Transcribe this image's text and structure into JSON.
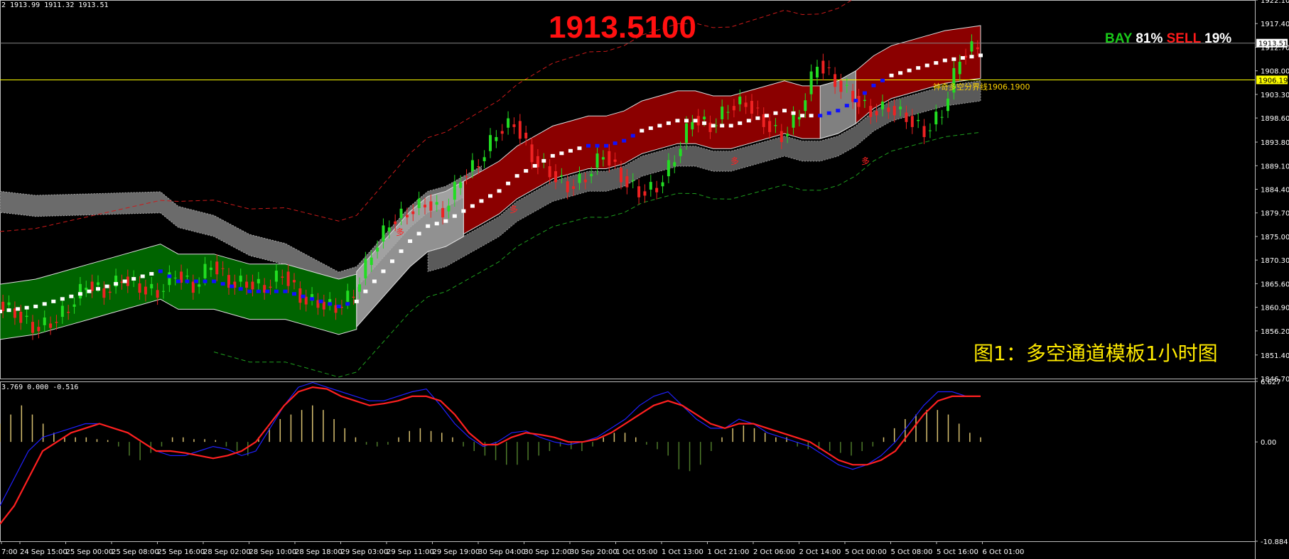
{
  "window": {
    "ohlc_header": "2 1913.99 1911.32 1913.51",
    "indicator_header": "3.769 0.000 -0.516"
  },
  "overlay": {
    "price_big": "1913.5100",
    "bay_label": "BAY",
    "bay_pct": "81%",
    "sell_label": "SELL",
    "sell_pct": "19%",
    "caption": "图1：多空通道模板1小时图",
    "reference_label": "神奇多空分界线1906.1900",
    "signal_mark": "多"
  },
  "colors": {
    "bull_channel": "#006400",
    "bear_channel": "#8b0000",
    "neutral_channel": "#808080",
    "bull_candle": "#22dd22",
    "bear_candle": "#ee2222",
    "mid_line": "#1010ff",
    "price_line": "#ffffff",
    "macd_fast": "#ff2020",
    "macd_slow": "#2020ff",
    "ref_line": "#ffff00"
  },
  "chart_data": [
    {
      "type": "line",
      "title": "",
      "xlabel": "",
      "ylabel": "",
      "ylim": [
        1846.7,
        1922.1
      ],
      "y_ticks": [
        "1922.10",
        "1917.40",
        "1912.70",
        "1908.00",
        "1903.30",
        "1898.60",
        "1893.80",
        "1889.10",
        "1884.40",
        "1879.70",
        "1875.00",
        "1870.30",
        "1865.60",
        "1860.90",
        "1856.20",
        "1851.40",
        "1846.70"
      ],
      "current_price_tag": "1913.51",
      "reference_price_tag": "1906.19",
      "current_price": 1913.51,
      "reference_price": 1906.19,
      "x_ticks": [
        "7:00",
        "24 Sep 15:00",
        "25 Sep 00:00",
        "25 Sep 08:00",
        "25 Sep 16:00",
        "28 Sep 02:00",
        "28 Sep 10:00",
        "28 Sep 18:00",
        "29 Sep 03:00",
        "29 Sep 11:00",
        "29 Sep 19:00",
        "30 Sep 04:00",
        "30 Sep 12:00",
        "30 Sep 20:00",
        "1 Oct 05:00",
        "1 Oct 13:00",
        "1 Oct 21:00",
        "2 Oct 06:00",
        "2 Oct 14:00",
        "5 Oct 00:00",
        "5 Oct 08:00",
        "5 Oct 16:00",
        "6 Oct 01:00"
      ],
      "series": [
        {
          "values": [
            1860,
            1860.5,
            1861,
            1862,
            1863,
            1864,
            1865,
            1866,
            1867,
            1868,
            1866,
            1866,
            1866,
            1865,
            1864,
            1864,
            1864,
            1863,
            1862,
            1861,
            1862,
            1866,
            1870,
            1874,
            1877,
            1878,
            1880,
            1882,
            1884,
            1887,
            1889,
            1891,
            1892,
            1893,
            1893,
            1894,
            1896,
            1897,
            1898,
            1898,
            1897,
            1897,
            1898,
            1899,
            1900,
            1899,
            1899,
            1900,
            1902,
            1905,
            1907,
            1908,
            1909,
            1910,
            1910.5,
            1911
          ]
        },
        {
          "values": [
            1862,
            1860,
            1857,
            1858,
            1861,
            1866,
            1864,
            1867,
            1865,
            1864,
            1868,
            1865,
            1870,
            1866,
            1866,
            1865,
            1868,
            1863,
            1862,
            1861,
            1864,
            1872,
            1878,
            1880,
            1882,
            1880,
            1887,
            1890,
            1896,
            1898,
            1891,
            1888,
            1885,
            1887,
            1892,
            1887,
            1884,
            1885,
            1891,
            1899,
            1897,
            1901,
            1902,
            1898,
            1895,
            1900,
            1910,
            1906,
            1903,
            1900,
            1901,
            1899,
            1896,
            1900,
            1911,
            1913.5
          ]
        }
      ],
      "macd": {
        "ylim": [
          -10.884,
          6.627
        ],
        "y_ticks": [
          "6.627",
          "0.00",
          "-10.884"
        ],
        "fast": [
          -9,
          -7,
          -4,
          -1,
          0,
          1,
          1.5,
          2,
          1.5,
          1,
          0,
          -1,
          -1,
          -1.2,
          -1.5,
          -1.8,
          -1.5,
          -1,
          0,
          2,
          4,
          5.5,
          6,
          5.8,
          5,
          4.5,
          4,
          4.2,
          4.5,
          5,
          5,
          4.5,
          3,
          1,
          -0.3,
          -0.3,
          0.5,
          1,
          0.8,
          0.5,
          0,
          0,
          0.3,
          1,
          2,
          3,
          4,
          4.5,
          4,
          3,
          2,
          1.5,
          2,
          2,
          1.5,
          1,
          0.5,
          0,
          -1,
          -2,
          -2.5,
          -2.5,
          -2,
          -1,
          1,
          3,
          4.5,
          5,
          5,
          5
        ],
        "slow": [
          -7,
          -4,
          -1,
          0.5,
          1,
          1.5,
          2,
          2,
          1.5,
          1,
          0,
          -1,
          -1.5,
          -1.5,
          -1,
          -0.5,
          -0.8,
          -1.5,
          -1,
          1.5,
          4,
          6,
          6.5,
          6,
          5.5,
          5,
          4.5,
          4.5,
          5,
          5.5,
          5.8,
          4,
          2,
          0.5,
          -0.5,
          0,
          1,
          1.2,
          0.5,
          0,
          -0.3,
          0,
          0.5,
          1.5,
          2.5,
          4,
          5,
          5.5,
          4,
          2.5,
          1.5,
          1.5,
          2.5,
          2,
          1,
          0.5,
          0,
          -0.5,
          -1.5,
          -2.5,
          -3,
          -2.5,
          -1.5,
          0,
          2,
          4,
          5.5,
          5.5,
          5,
          5
        ],
        "histogram": [
          2,
          3,
          4,
          3,
          2,
          1,
          0.5,
          0.5,
          0.5,
          0.3,
          0.2,
          -0.5,
          -1.5,
          -2,
          -1.2,
          -0.5,
          0.5,
          0.5,
          0.3,
          0.3,
          0.2,
          -0.5,
          -1,
          -1.5,
          0.5,
          1.5,
          2.5,
          3,
          3.5,
          4,
          3.5,
          2.5,
          1.5,
          0.5,
          -0.3,
          -0.5,
          -0.3,
          0.5,
          1.2,
          1.5,
          1.2,
          1,
          0.5,
          -0.5,
          -1,
          -1.5,
          -2,
          -2.5,
          -2.5,
          -2,
          -1.5,
          -1,
          -0.5,
          -0.8,
          -1,
          -0.5,
          0.5,
          1,
          1,
          0.5,
          -0.3,
          -0.8,
          -1.5,
          -3,
          -3.2,
          -2.5,
          -1,
          0.5,
          1.5,
          1.8,
          1.5,
          1,
          0.5,
          0.5,
          -0.5,
          -0.8,
          -0.8,
          -1,
          -1.2,
          -1.5,
          -1,
          -0.5,
          0.5,
          1.5,
          2.5,
          3,
          3.5,
          3.5,
          3,
          2,
          1,
          0.5
        ]
      }
    }
  ]
}
